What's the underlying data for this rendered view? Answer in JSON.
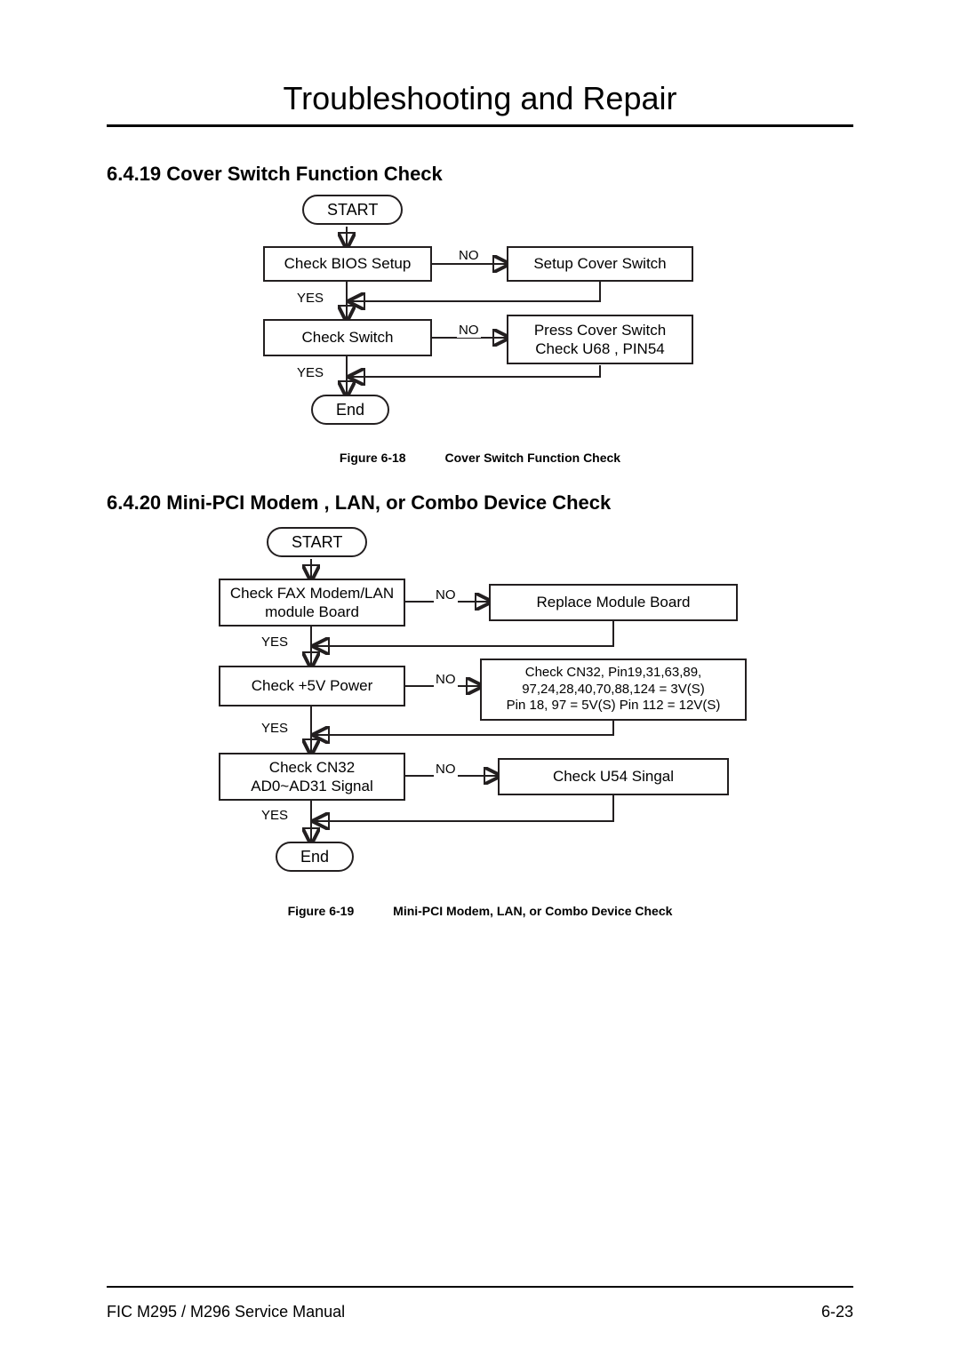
{
  "page": {
    "title": "Troubleshooting and Repair",
    "footer_left": "FIC M295 / M296 Service Manual",
    "footer_right": "6-23"
  },
  "section1": {
    "heading": "6.4.19  Cover Switch Function Check",
    "figure_num": "Figure 6-18",
    "figure_title": "Cover Switch Function Check"
  },
  "section2": {
    "heading": "6.4.20  Mini-PCI Modem , LAN, or Combo Device Check",
    "figure_num": "Figure 6-19",
    "figure_title": "Mini-PCI Modem, LAN, or Combo Device Check"
  },
  "flow1": {
    "start": "START",
    "step1": "Check BIOS Setup",
    "step1_no": "Setup Cover Switch",
    "step2": "Check Switch",
    "step2_no_l1": "Press Cover Switch",
    "step2_no_l2": "Check U68  , PIN54",
    "end": "End",
    "yes": "YES",
    "no": "NO"
  },
  "flow2": {
    "start": "START",
    "step1_l1": "Check FAX Modem/LAN",
    "step1_l2": "module Board",
    "step1_no": "Replace Module Board",
    "step2": "Check +5V Power",
    "step2_no_l1": "Check  CN32, Pin19,31,63,89,",
    "step2_no_l2": "97,24,28,40,70,88,124 = 3V(S)",
    "step2_no_l3": "Pin 18, 97 = 5V(S) Pin 112 = 12V(S)",
    "step3_l1": "Check CN32",
    "step3_l2": "AD0~AD31 Signal",
    "step3_no": "Check U54 Singal",
    "end": "End",
    "yes": "YES",
    "no": "NO"
  },
  "chart_data": [
    {
      "type": "flowchart",
      "title": "Cover Switch Function Check",
      "nodes": [
        {
          "id": "s",
          "kind": "terminator",
          "label": "START"
        },
        {
          "id": "p1",
          "kind": "process",
          "label": "Check BIOS Setup"
        },
        {
          "id": "a1",
          "kind": "process",
          "label": "Setup Cover Switch"
        },
        {
          "id": "p2",
          "kind": "process",
          "label": "Check Switch"
        },
        {
          "id": "a2",
          "kind": "process",
          "label": "Press Cover Switch\nCheck U68 , PIN54"
        },
        {
          "id": "e",
          "kind": "terminator",
          "label": "End"
        }
      ],
      "edges": [
        {
          "from": "s",
          "to": "p1"
        },
        {
          "from": "p1",
          "to": "a1",
          "label": "NO"
        },
        {
          "from": "p1",
          "to": "p2",
          "label": "YES"
        },
        {
          "from": "a1",
          "to": "p2"
        },
        {
          "from": "p2",
          "to": "a2",
          "label": "NO"
        },
        {
          "from": "p2",
          "to": "e",
          "label": "YES"
        },
        {
          "from": "a2",
          "to": "e"
        }
      ]
    },
    {
      "type": "flowchart",
      "title": "Mini-PCI Modem, LAN, or Combo Device Check",
      "nodes": [
        {
          "id": "s",
          "kind": "terminator",
          "label": "START"
        },
        {
          "id": "p1",
          "kind": "process",
          "label": "Check FAX Modem/LAN\nmodule Board"
        },
        {
          "id": "a1",
          "kind": "process",
          "label": "Replace Module Board"
        },
        {
          "id": "p2",
          "kind": "process",
          "label": "Check +5V Power"
        },
        {
          "id": "a2",
          "kind": "process",
          "label": "Check CN32, Pin19,31,63,89,\n97,24,28,40,70,88,124 = 3V(S)\nPin 18, 97 = 5V(S) Pin 112 = 12V(S)"
        },
        {
          "id": "p3",
          "kind": "process",
          "label": "Check CN32\nAD0~AD31 Signal"
        },
        {
          "id": "a3",
          "kind": "process",
          "label": "Check U54 Singal"
        },
        {
          "id": "e",
          "kind": "terminator",
          "label": "End"
        }
      ],
      "edges": [
        {
          "from": "s",
          "to": "p1"
        },
        {
          "from": "p1",
          "to": "a1",
          "label": "NO"
        },
        {
          "from": "p1",
          "to": "p2",
          "label": "YES"
        },
        {
          "from": "a1",
          "to": "p2"
        },
        {
          "from": "p2",
          "to": "a2",
          "label": "NO"
        },
        {
          "from": "p2",
          "to": "p3",
          "label": "YES"
        },
        {
          "from": "a2",
          "to": "p3"
        },
        {
          "from": "p3",
          "to": "a3",
          "label": "NO"
        },
        {
          "from": "p3",
          "to": "e",
          "label": "YES"
        },
        {
          "from": "a3",
          "to": "e"
        }
      ]
    }
  ]
}
